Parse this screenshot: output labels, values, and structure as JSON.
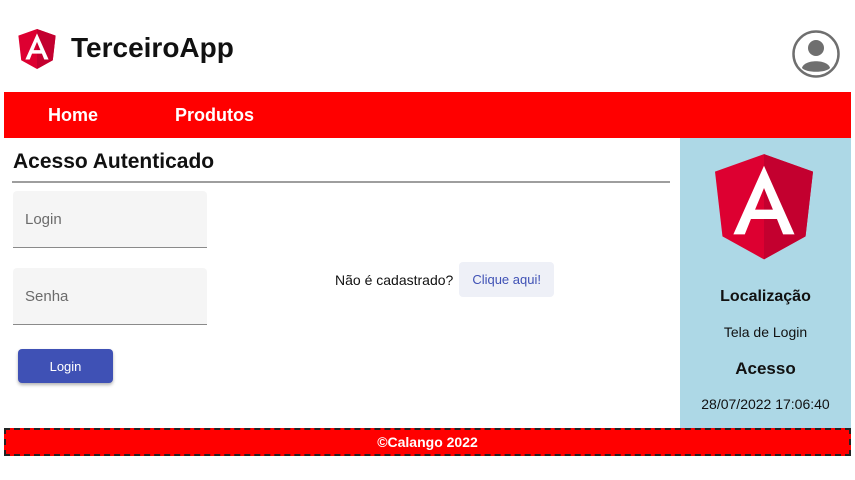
{
  "header": {
    "app_title": "TerceiroApp",
    "logo_icon": "angular-logo-icon",
    "avatar_icon": "user-avatar-icon"
  },
  "nav": {
    "items": [
      {
        "label": "Home"
      },
      {
        "label": "Produtos"
      }
    ]
  },
  "main": {
    "title": "Acesso Autenticado",
    "login_field": {
      "placeholder": "Login",
      "value": ""
    },
    "password_field": {
      "placeholder": "Senha",
      "value": ""
    },
    "login_button": "Login",
    "register_prompt": "Não é cadastrado?",
    "register_link": "Clique aqui!"
  },
  "aside": {
    "logo_icon": "angular-logo-icon",
    "location_heading": "Localização",
    "location_value": "Tela de Login",
    "access_heading": "Acesso",
    "access_value": "28/07/2022 17:06:40"
  },
  "footer": {
    "text": "©Calango 2022"
  },
  "colors": {
    "nav_background": "#ff0000",
    "aside_background": "#add8e6",
    "primary_button": "#3f51b5",
    "angular_red": "#dd0031",
    "angular_dark_red": "#c3002f"
  }
}
